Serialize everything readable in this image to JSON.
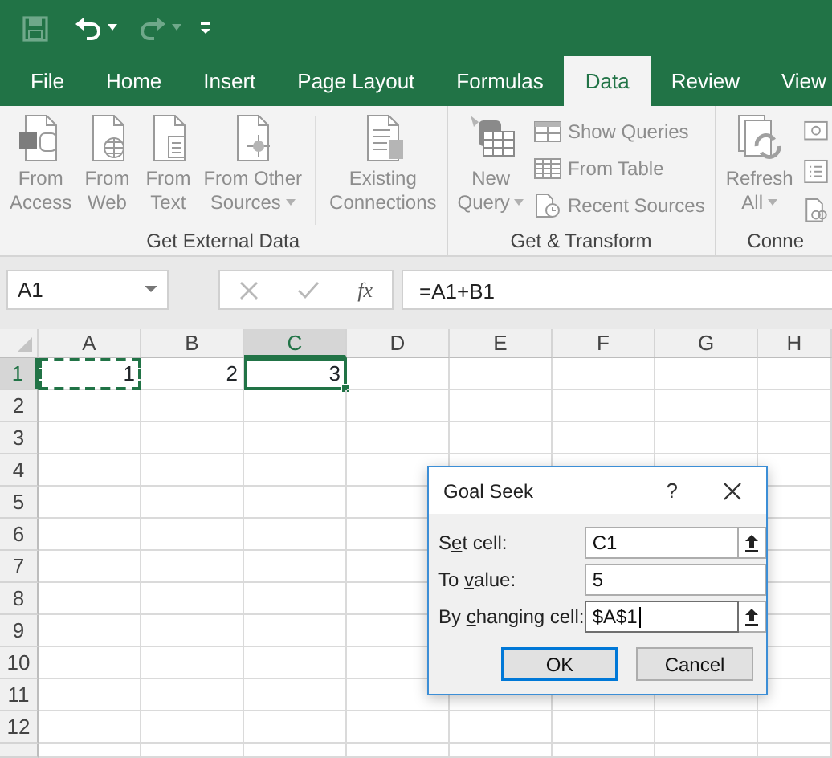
{
  "quick_access": [
    {
      "kind": "save",
      "disabled": true,
      "dropdown": false
    },
    {
      "kind": "undo",
      "disabled": false,
      "dropdown": true
    },
    {
      "kind": "redo",
      "disabled": true,
      "dropdown": true
    },
    {
      "kind": "customize",
      "disabled": false,
      "dropdown": false
    }
  ],
  "tabs": [
    {
      "label": "File",
      "selected": false
    },
    {
      "label": "Home",
      "selected": false
    },
    {
      "label": "Insert",
      "selected": false
    },
    {
      "label": "Page Layout",
      "selected": false
    },
    {
      "label": "Formulas",
      "selected": false
    },
    {
      "label": "Data",
      "selected": true
    },
    {
      "label": "Review",
      "selected": false
    },
    {
      "label": "View",
      "selected": false
    }
  ],
  "ribbon_groups": [
    {
      "label": "Get External Data",
      "items": [
        {
          "kind": "access",
          "lines": [
            "From",
            "Access"
          ],
          "dropdown": false
        },
        {
          "kind": "web",
          "lines": [
            "From",
            "Web"
          ],
          "dropdown": false
        },
        {
          "kind": "text",
          "lines": [
            "From",
            "Text"
          ],
          "dropdown": false
        },
        {
          "kind": "other",
          "lines": [
            "From Other",
            "Sources"
          ],
          "dropdown": true
        },
        {
          "kind": "separator"
        },
        {
          "kind": "connections",
          "lines": [
            "Existing",
            "Connections"
          ],
          "dropdown": false
        }
      ]
    },
    {
      "label": "Get & Transform",
      "items": [
        {
          "kind": "query",
          "lines": [
            "New",
            "Query"
          ],
          "dropdown": true
        }
      ],
      "small_items": [
        {
          "kind": "show-queries",
          "label": "Show Queries"
        },
        {
          "kind": "from-table",
          "label": "From Table"
        },
        {
          "kind": "recent",
          "label": "Recent Sources"
        }
      ]
    },
    {
      "label": "Conne",
      "items": [
        {
          "kind": "refresh",
          "lines": [
            "Refresh",
            "All"
          ],
          "dropdown": true
        }
      ],
      "small_items": [
        {
          "kind": "connections-small"
        },
        {
          "kind": "properties-small"
        },
        {
          "kind": "links-small"
        }
      ]
    }
  ],
  "name_box": {
    "value": "A1"
  },
  "formula_bar": {
    "function_label": "fx",
    "value": "=A1+B1"
  },
  "columns": [
    {
      "label": "A",
      "selected": false
    },
    {
      "label": "B",
      "selected": false
    },
    {
      "label": "C",
      "selected": true
    },
    {
      "label": "D",
      "selected": false
    },
    {
      "label": "E",
      "selected": false
    },
    {
      "label": "F",
      "selected": false
    },
    {
      "label": "G",
      "selected": false
    },
    {
      "label": "H",
      "selected": false
    }
  ],
  "rows": [
    {
      "label": "1",
      "selected": true,
      "cells": [
        {
          "text": "1",
          "selected": false,
          "copy_marquee": true
        },
        {
          "text": "2",
          "selected": false,
          "copy_marquee": false
        },
        {
          "text": "3",
          "selected": true,
          "copy_marquee": false
        }
      ]
    },
    {
      "label": "2",
      "selected": false,
      "cells": []
    },
    {
      "label": "3",
      "selected": false,
      "cells": []
    },
    {
      "label": "4",
      "selected": false,
      "cells": []
    },
    {
      "label": "5",
      "selected": false,
      "cells": []
    },
    {
      "label": "6",
      "selected": false,
      "cells": []
    },
    {
      "label": "7",
      "selected": false,
      "cells": []
    },
    {
      "label": "8",
      "selected": false,
      "cells": []
    },
    {
      "label": "9",
      "selected": false,
      "cells": []
    },
    {
      "label": "10",
      "selected": false,
      "cells": []
    },
    {
      "label": "11",
      "selected": false,
      "cells": []
    },
    {
      "label": "12",
      "selected": false,
      "cells": []
    }
  ],
  "dialog": {
    "title": "Goal Seek",
    "help": "?",
    "fields": [
      {
        "label_parts": [
          "S",
          "e",
          "t cell:"
        ],
        "value": "C1",
        "ref_button": true,
        "focused": false
      },
      {
        "label_parts": [
          "To ",
          "v",
          "alue:"
        ],
        "value": "5",
        "ref_button": false,
        "focused": false
      },
      {
        "label_parts": [
          "By ",
          "c",
          "hanging cell:"
        ],
        "value": "$A$1",
        "ref_button": true,
        "focused": true
      }
    ],
    "buttons": [
      {
        "label": "OK",
        "default": true
      },
      {
        "label": "Cancel",
        "default": false
      }
    ]
  }
}
